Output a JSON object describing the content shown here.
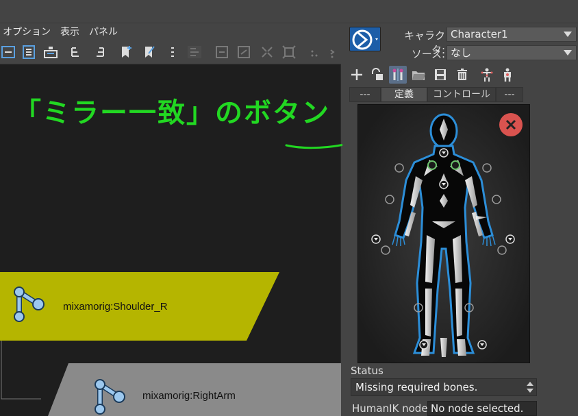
{
  "menu": [
    "オプション",
    "表示",
    "パネル"
  ],
  "annotation": "「ミラー一致」のボタン",
  "nodes": [
    {
      "label": "mixamorig:Shoulder_R"
    },
    {
      "label": "mixamorig:RightArm"
    }
  ],
  "hik_panel": {
    "character_label": "キャラクタ:",
    "character_value": "Character1",
    "source_label": "ソース:",
    "source_value": "なし",
    "tabs": [
      "---",
      "定義",
      "コントロール",
      "---"
    ],
    "status_label": "Status",
    "status_value": "Missing required bones.",
    "node_label": "HumanIK node",
    "node_value": "No node selected."
  },
  "colors": {
    "annotation": "#22d822",
    "node_selected": "#b5b500",
    "node_default": "#8a8a8a",
    "close_button": "#d9534f",
    "figure_outline": "#2c8ed8"
  }
}
